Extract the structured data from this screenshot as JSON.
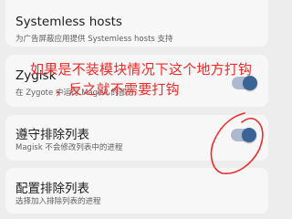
{
  "colors": {
    "background": "#ededed",
    "card": "#f7f7f7",
    "toggle_track": "#aeb9d0",
    "toggle_knob": "#3b6496",
    "annotation_red": "#ee2a2a"
  },
  "settings": {
    "systemless_hosts": {
      "title": "Systemless hosts",
      "subtitle": "为广告屏蔽应用提供 Systemless hosts 支持"
    },
    "zygisk": {
      "title": "Zygisk",
      "subtitle": "在 Zygote 中运行 Magisk 的部分",
      "enabled": true
    },
    "enforce_denylist": {
      "title": "遵守排除列表",
      "subtitle": "Magisk 不会修改列表中的进程",
      "enabled": true
    },
    "configure_denylist": {
      "title": "配置排除列表",
      "subtitle": "选择加入排除列表的进程"
    }
  },
  "annotation": {
    "line1": "如果是不装模块情况下这个地方打钩",
    "line2": "，反之就不需要打钩"
  }
}
